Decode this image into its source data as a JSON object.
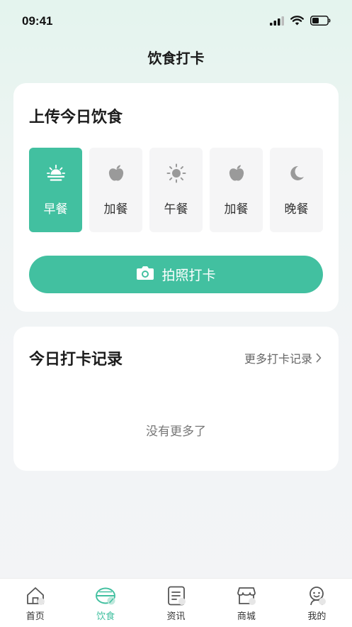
{
  "status_bar": {
    "time": "09:41"
  },
  "header": {
    "title": "饮食打卡"
  },
  "upload_card": {
    "title": "上传今日饮食",
    "meals": [
      {
        "label": "早餐",
        "icon": "sunrise-icon",
        "active": true
      },
      {
        "label": "加餐",
        "icon": "apple-icon",
        "active": false
      },
      {
        "label": "午餐",
        "icon": "sun-icon",
        "active": false
      },
      {
        "label": "加餐",
        "icon": "apple-icon",
        "active": false
      },
      {
        "label": "晚餐",
        "icon": "moon-icon",
        "active": false
      }
    ],
    "photo_button_label": "拍照打卡"
  },
  "records_card": {
    "title": "今日打卡记录",
    "more_link": "更多打卡记录",
    "empty_text": "没有更多了"
  },
  "tabbar": {
    "items": [
      {
        "label": "首页",
        "icon": "home-icon",
        "active": false
      },
      {
        "label": "饮食",
        "icon": "diet-bowl-icon",
        "active": true
      },
      {
        "label": "资讯",
        "icon": "news-icon",
        "active": false
      },
      {
        "label": "商城",
        "icon": "store-icon",
        "active": false
      },
      {
        "label": "我的",
        "icon": "profile-icon",
        "active": false
      }
    ]
  },
  "colors": {
    "accent": "#42c0a0",
    "inactive_icon": "#9a9a9a",
    "background": "#f2f4f6"
  }
}
